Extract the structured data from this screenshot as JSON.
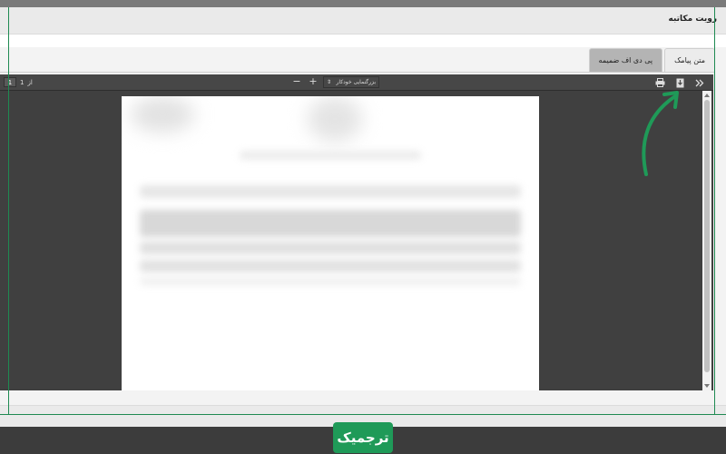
{
  "dialog": {
    "title": "رویت مکاتبه"
  },
  "tabs": [
    {
      "label": "متن پیامک",
      "active": false
    },
    {
      "label": "پی دی اف ضمیمه",
      "active": true
    }
  ],
  "viewer": {
    "page_of_label": "از",
    "current_page": "1",
    "total_pages": "1",
    "zoom_label": "بزرگنمایی خودکار",
    "zoom_in": "+",
    "zoom_out": "−",
    "icons": {
      "print": "print-icon",
      "download": "download-icon",
      "sidebar_toggle": "double-chevron-icon"
    }
  },
  "watermark": {
    "text": "ترجمیک"
  },
  "colors": {
    "accent": "#1f9a58",
    "viewer_bg": "#404040"
  }
}
